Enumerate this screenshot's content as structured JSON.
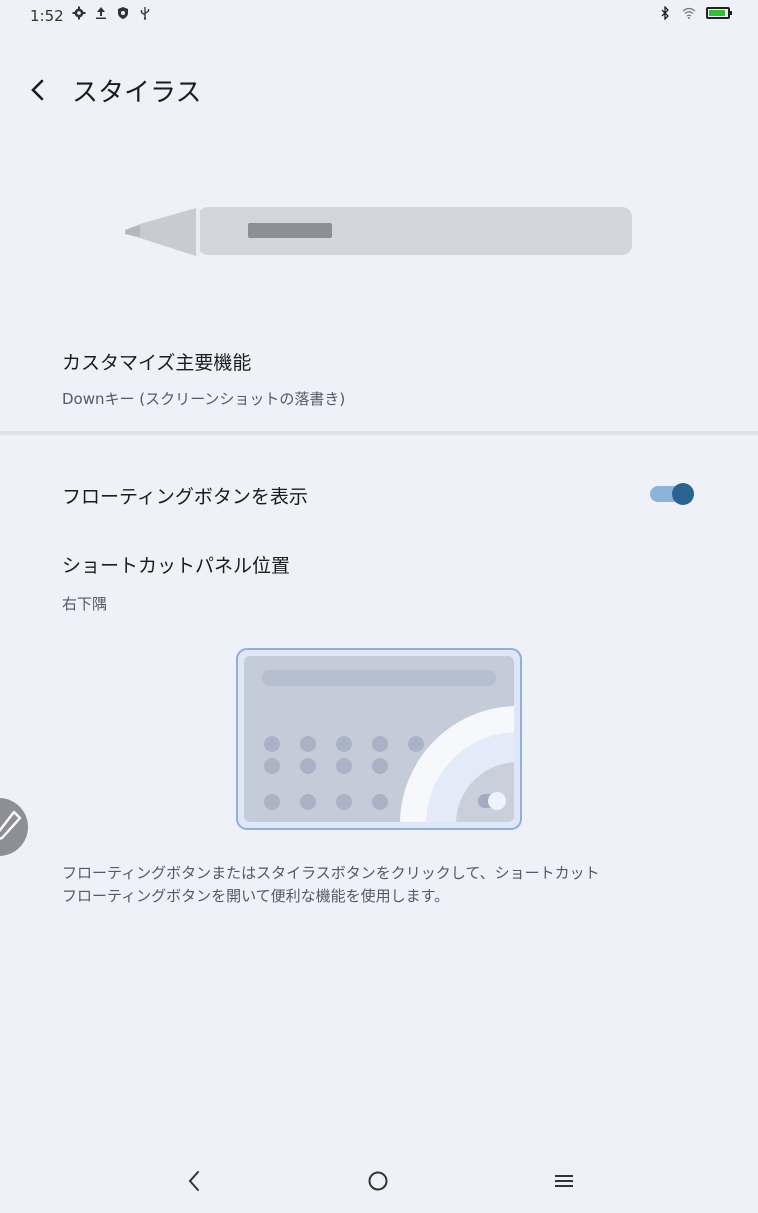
{
  "status_bar": {
    "time": "1:52",
    "left_icons": [
      "settings-gear-icon",
      "upload-icon",
      "shield-icon",
      "usb-icon"
    ],
    "right_icons": [
      "bluetooth-icon",
      "wifi-icon",
      "battery-icon"
    ],
    "battery_color": "#2fbf2f"
  },
  "app_bar": {
    "title": "スタイラス"
  },
  "main_function": {
    "title": "カスタマイズ主要機能",
    "value": "Downキー (スクリーンショットの落書き)"
  },
  "floating_button_setting": {
    "title": "フローティングボタンを表示",
    "enabled": true
  },
  "shortcut_panel_position": {
    "title": "ショートカットパネル位置",
    "value": "右下隅"
  },
  "description": {
    "line1": "フローティングボタンまたはスタイラスボタンをクリックして、ショートカット",
    "line2": "フローティングボタンを開いて便利な機能を使用します。"
  },
  "colors": {
    "background": "#eef1f8",
    "accent": "#2b6390",
    "accent_light": "#8bb4d8"
  }
}
